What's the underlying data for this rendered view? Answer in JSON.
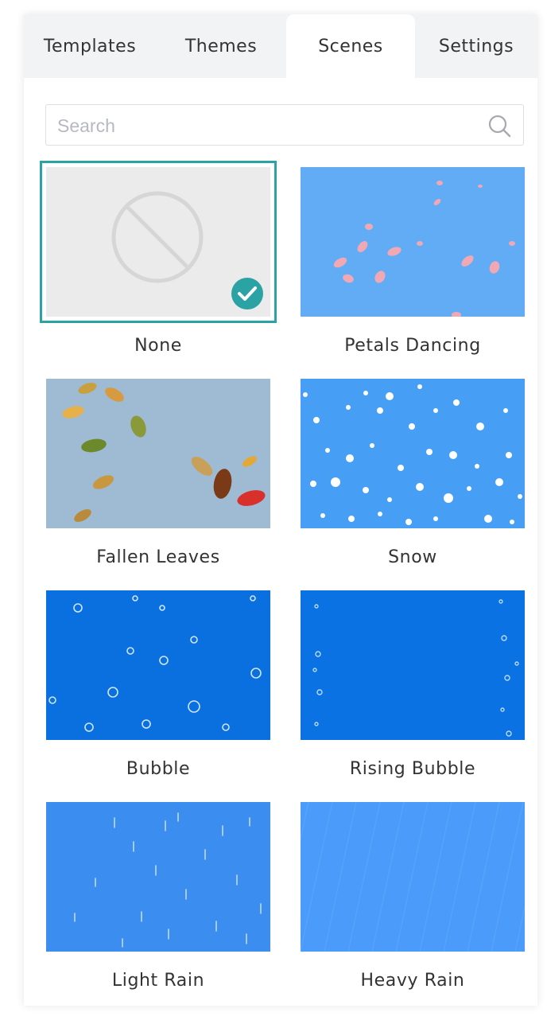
{
  "tabs": [
    {
      "label": "Templates",
      "active": false
    },
    {
      "label": "Themes",
      "active": false
    },
    {
      "label": "Scenes",
      "active": true
    },
    {
      "label": "Settings",
      "active": false
    }
  ],
  "search": {
    "placeholder": "Search",
    "value": "",
    "icon": "search-icon"
  },
  "scenes": [
    {
      "id": "none",
      "label": "None",
      "selected": true,
      "icon": "none-icon"
    },
    {
      "id": "petals",
      "label": "Petals Dancing",
      "selected": false
    },
    {
      "id": "leaves",
      "label": "Fallen Leaves",
      "selected": false
    },
    {
      "id": "snow",
      "label": "Snow",
      "selected": false
    },
    {
      "id": "bubble",
      "label": "Bubble",
      "selected": false
    },
    {
      "id": "rising-bubble",
      "label": "Rising Bubble",
      "selected": false
    },
    {
      "id": "light-rain",
      "label": "Light Rain",
      "selected": false
    },
    {
      "id": "heavy-rain",
      "label": "Heavy Rain",
      "selected": false
    }
  ],
  "colors": {
    "accent": "#2ba3a5",
    "tabbar_bg": "#f2f3f5",
    "none_bg": "#ebebeb",
    "petals_bg": "#62acf5",
    "leaves_bg": "#9fbad3",
    "snow_bg": "#479ef5",
    "bubble_bg": "#0a6fdf",
    "rising_bubble_bg": "#0a72e3",
    "light_rain_bg": "#3b8ef0",
    "heavy_rain_bg": "#4a9bfa"
  }
}
